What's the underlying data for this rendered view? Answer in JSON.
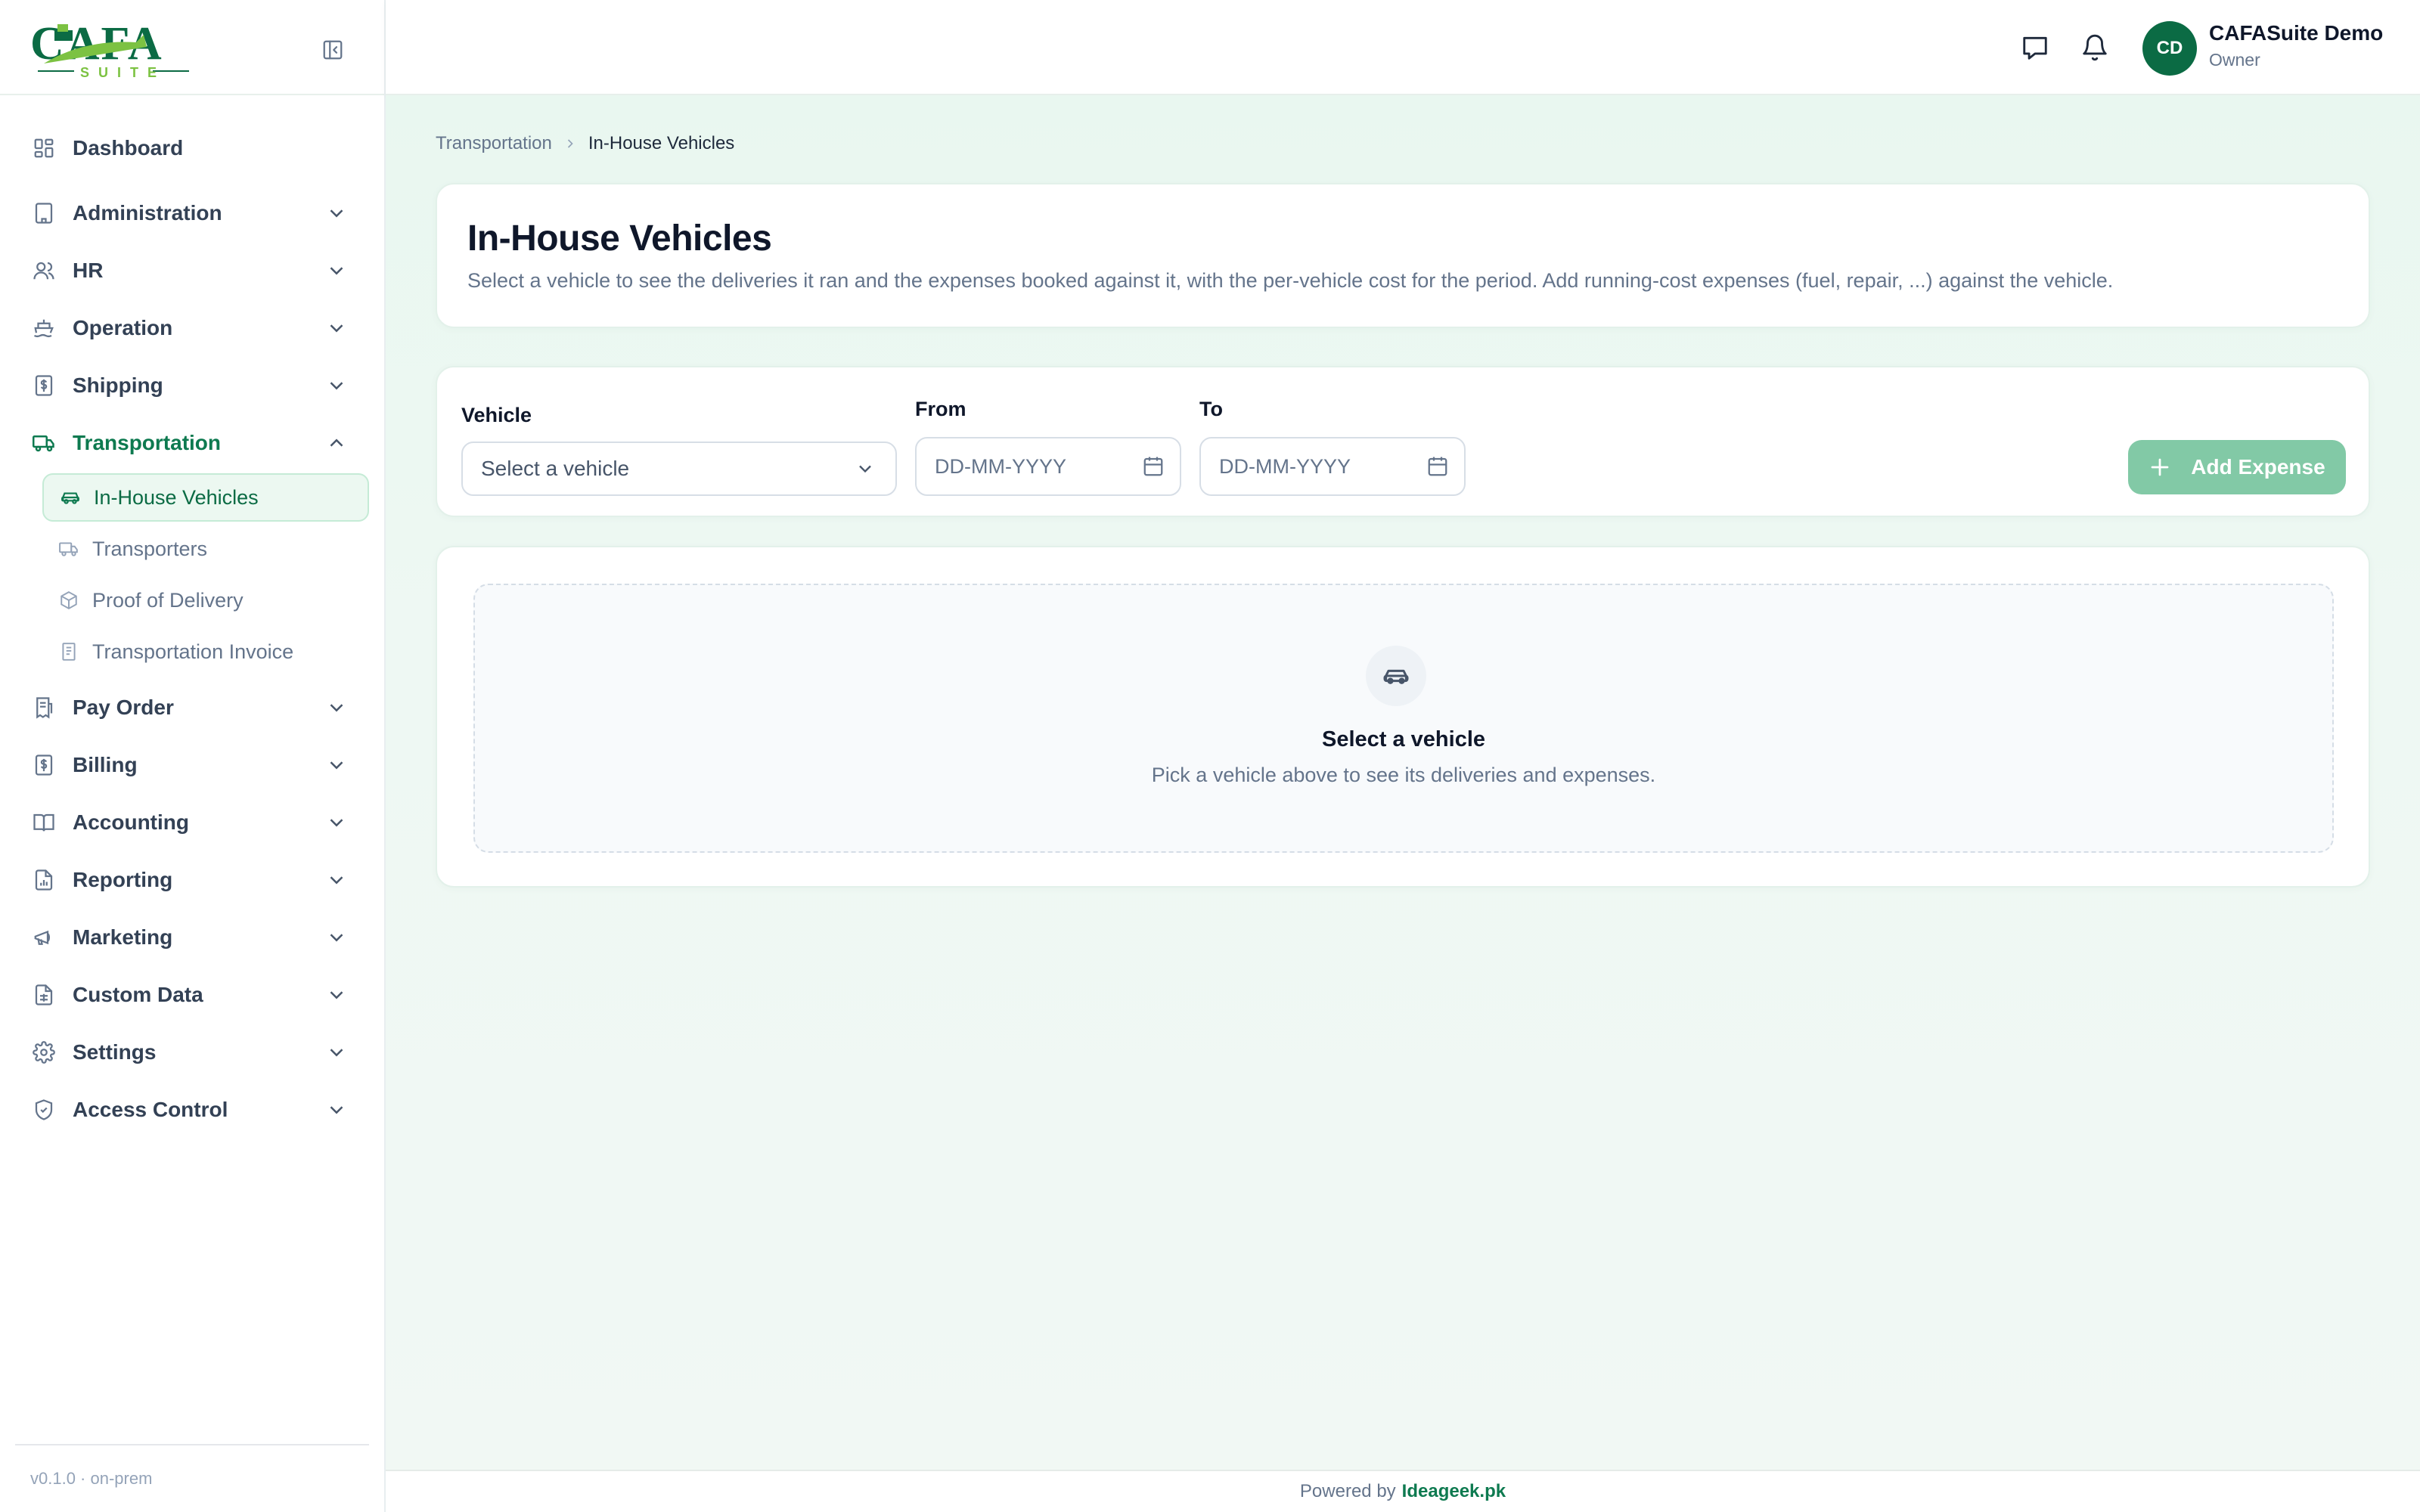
{
  "brand": {
    "logo_text": "CAFA",
    "logo_sub": "SUITE",
    "version": "v0.1.0 · on-prem",
    "colors": {
      "primary": "#0b6b44",
      "accent": "#7cc242",
      "button_disabled": "#82c9a6"
    }
  },
  "sidebar": {
    "items": [
      {
        "label": "Dashboard",
        "icon": "dashboard-icon"
      },
      {
        "label": "Administration",
        "icon": "building-icon"
      },
      {
        "label": "HR",
        "icon": "users-icon"
      },
      {
        "label": "Operation",
        "icon": "ship-icon"
      },
      {
        "label": "Shipping",
        "icon": "dollar-doc-icon"
      },
      {
        "label": "Transportation",
        "icon": "truck-icon",
        "expanded": true
      },
      {
        "label": "Pay Order",
        "icon": "receipt-icon"
      },
      {
        "label": "Billing",
        "icon": "invoice-icon"
      },
      {
        "label": "Accounting",
        "icon": "book-icon"
      },
      {
        "label": "Reporting",
        "icon": "report-icon"
      },
      {
        "label": "Marketing",
        "icon": "megaphone-icon"
      },
      {
        "label": "Custom Data",
        "icon": "table-doc-icon"
      },
      {
        "label": "Settings",
        "icon": "gear-icon"
      },
      {
        "label": "Access Control",
        "icon": "shield-icon"
      }
    ],
    "transportation_subitems": [
      {
        "label": "In-House Vehicles",
        "icon": "car-icon",
        "active": true
      },
      {
        "label": "Transporters",
        "icon": "truck-icon"
      },
      {
        "label": "Proof of Delivery",
        "icon": "package-icon"
      },
      {
        "label": "Transportation Invoice",
        "icon": "document-icon"
      }
    ]
  },
  "topbar": {
    "avatar_initials": "CD",
    "user_name": "CAFASuite Demo",
    "user_role": "Owner"
  },
  "breadcrumb": {
    "parent": "Transportation",
    "current": "In-House Vehicles"
  },
  "page": {
    "title": "In-House Vehicles",
    "description": "Select a vehicle to see the deliveries it ran and the expenses booked against it, with the per-vehicle cost for the period. Add running-cost expenses (fuel, repair, ...) against the vehicle."
  },
  "filters": {
    "vehicle_label": "Vehicle",
    "vehicle_placeholder": "Select a vehicle",
    "from_label": "From",
    "from_placeholder": "DD-MM-YYYY",
    "to_label": "To",
    "to_placeholder": "DD-MM-YYYY",
    "add_expense_label": "Add Expense"
  },
  "empty_state": {
    "title": "Select a vehicle",
    "subtitle": "Pick a vehicle above to see its deliveries and expenses."
  },
  "footer": {
    "prefix": "Powered by",
    "brand": "Ideageek.pk"
  }
}
